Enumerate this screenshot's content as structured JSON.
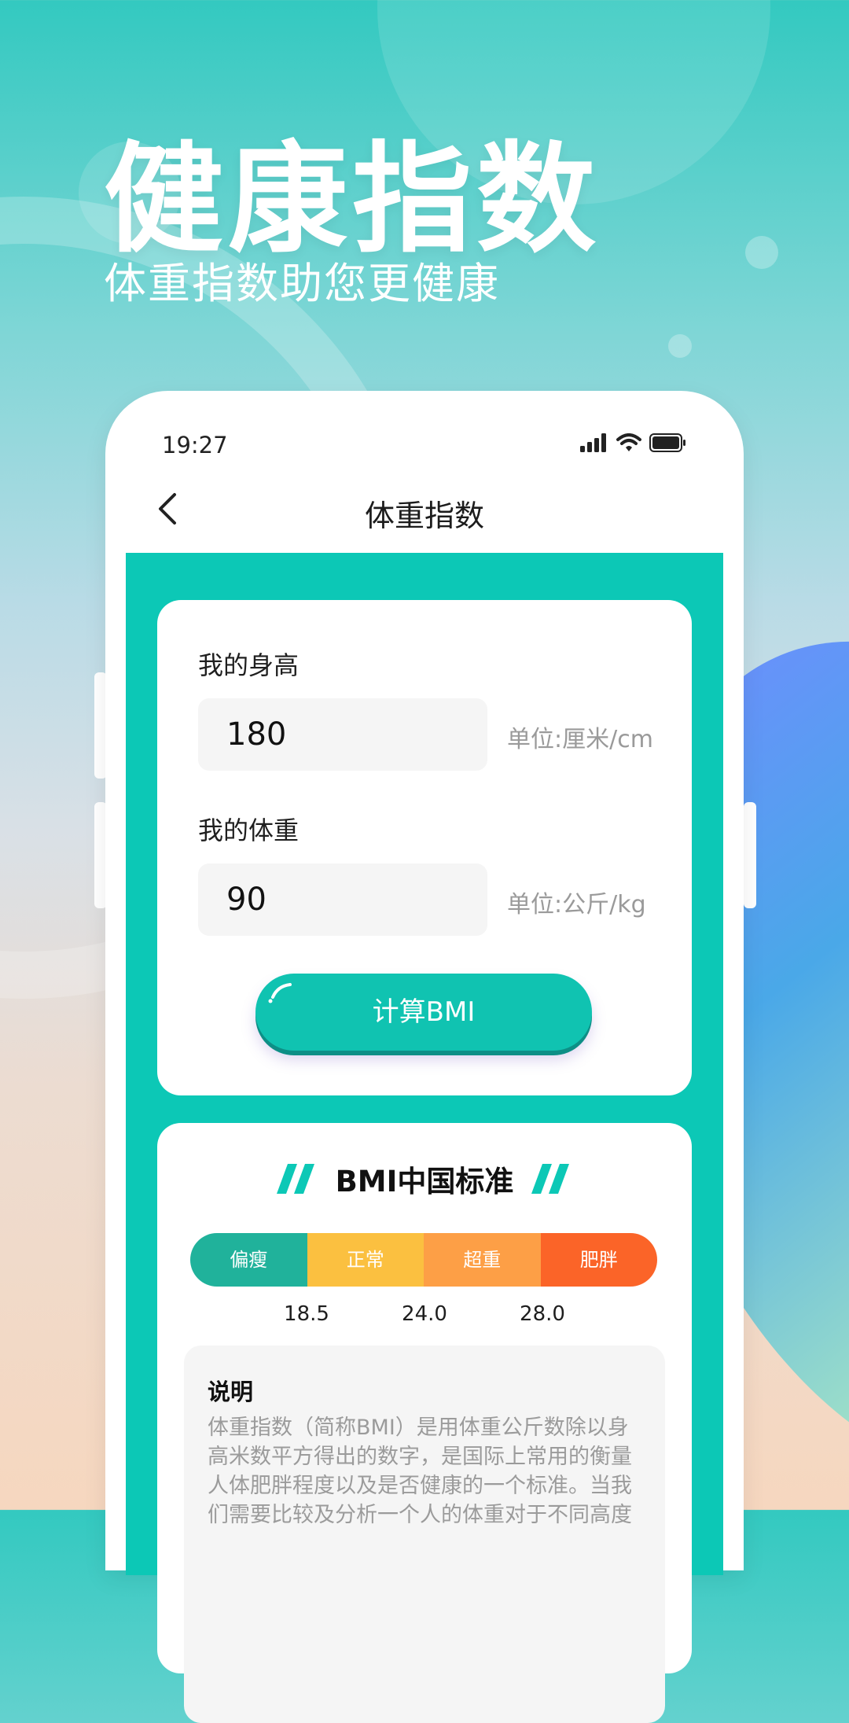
{
  "hero": {
    "title": "健康指数",
    "subtitle": "体重指数助您更健康"
  },
  "status_bar": {
    "time": "19:27"
  },
  "nav": {
    "title": "体重指数"
  },
  "height_field": {
    "label": "我的身高",
    "value": "180",
    "unit": "单位:厘米/cm"
  },
  "weight_field": {
    "label": "我的体重",
    "value": "90",
    "unit": "单位:公斤/kg"
  },
  "calc_button": {
    "label": "计算BMI"
  },
  "standard": {
    "title": "BMI中国标准",
    "segments": [
      {
        "label": "偏瘦",
        "color": "#20b29b"
      },
      {
        "label": "正常",
        "color": "#fbc040"
      },
      {
        "label": "超重",
        "color": "#fd9f46"
      },
      {
        "label": "肥胖",
        "color": "#fb6428"
      }
    ],
    "thresholds": [
      "18.5",
      "24.0",
      "28.0"
    ]
  },
  "description": {
    "title": "说明",
    "text": "体重指数（简称BMI）是用体重公斤数除以身高米数平方得出的数字，是国际上常用的衡量人体肥胖程度以及是否健康的一个标准。当我们需要比较及分析一个人的体重对于不同高度"
  },
  "colors": {
    "accent": "#0cc8b6",
    "button": "#10c3b1"
  }
}
